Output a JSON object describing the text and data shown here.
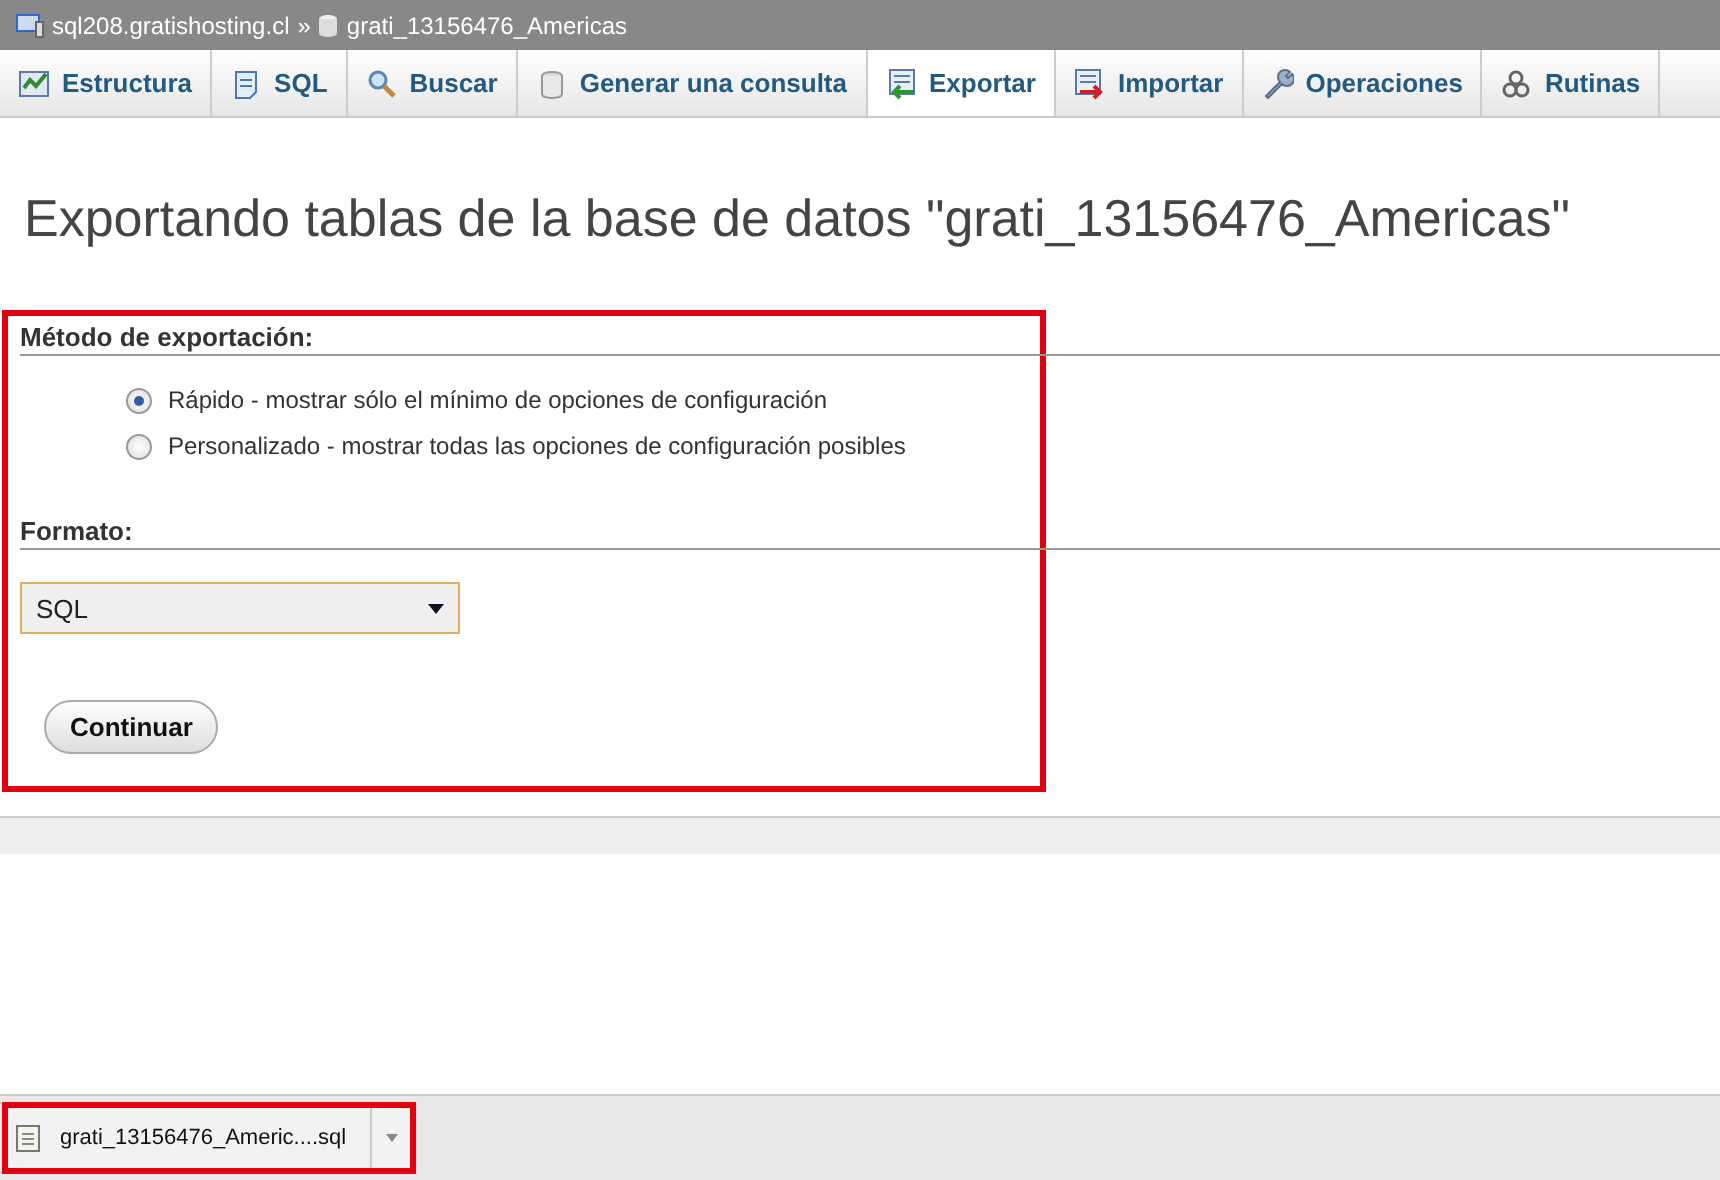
{
  "breadcrumb": {
    "server": "sql208.gratishosting.cl",
    "separator": "»",
    "database": "grati_13156476_Americas"
  },
  "tabs": [
    {
      "label": "Estructura",
      "selected": false
    },
    {
      "label": "SQL",
      "selected": false
    },
    {
      "label": "Buscar",
      "selected": false
    },
    {
      "label": "Generar una consulta",
      "selected": false
    },
    {
      "label": "Exportar",
      "selected": true
    },
    {
      "label": "Importar",
      "selected": false
    },
    {
      "label": "Operaciones",
      "selected": false
    },
    {
      "label": "Rutinas",
      "selected": false
    }
  ],
  "title": "Exportando tablas de la base de datos \"grati_13156476_Americas\"",
  "export_method": {
    "heading": "Método de exportación:",
    "options": [
      {
        "label": "Rápido - mostrar sólo el mínimo de opciones de configuración",
        "selected": true
      },
      {
        "label": "Personalizado - mostrar todas las opciones de configuración posibles",
        "selected": false
      }
    ]
  },
  "format": {
    "heading": "Formato:",
    "value": "SQL"
  },
  "continue_button": "Continuar",
  "download_bar": {
    "file": "grati_13156476_Americ....sql"
  }
}
